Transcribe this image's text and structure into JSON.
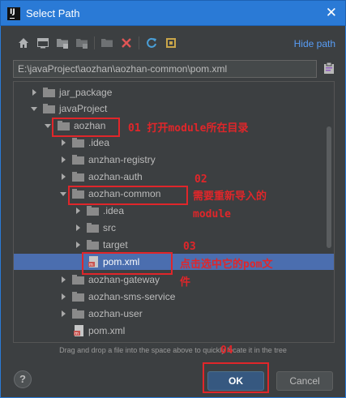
{
  "window": {
    "title": "Select Path",
    "close_glyph": "✕",
    "app_icon_letter": "IJ"
  },
  "toolbar": {
    "icons": [
      "home-icon",
      "desktop-icon",
      "project-icon",
      "module-icon",
      "new-folder-icon",
      "delete-icon",
      "refresh-icon",
      "show-hidden-icon"
    ],
    "hide_path_label": "Hide path"
  },
  "path": {
    "value": "E:\\javaProject\\aozhan\\aozhan-common\\pom.xml"
  },
  "tree": {
    "jar_package": "jar_package",
    "javaProject": "javaProject",
    "aozhan": "aozhan",
    "idea1": ".idea",
    "anzhan_registry": "anzhan-registry",
    "aozhan_auth": "aozhan-auth",
    "aozhan_common": "aozhan-common",
    "idea2": ".idea",
    "src": "src",
    "target": "target",
    "pom_selected": "pom.xml",
    "aozhan_gateway": "aozhan-gateway",
    "aozhan_sms_service": "aozhan-sms-service",
    "aozhan_user": "aozhan-user",
    "pom_root": "pom.xml"
  },
  "hint": "Drag and drop a file into the space above to quickly locate it in the tree",
  "buttons": {
    "help": "?",
    "ok": "OK",
    "cancel": "Cancel"
  },
  "annotations": {
    "a01": "01 打开module所在目录",
    "a02_line1": "02",
    "a02_line2": "需要重新导入的",
    "a02_line3": "module",
    "a03_line1": "03",
    "a03_line2": "点击选中它的pom文",
    "a03_line3": "件",
    "a04": "04"
  },
  "colors": {
    "accent": "#2a7ad6",
    "selection": "#4b6eaf",
    "annotation_red": "#e0262a",
    "link": "#589df6"
  }
}
